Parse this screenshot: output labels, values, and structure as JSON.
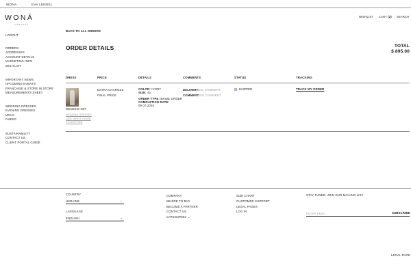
{
  "topbar": {
    "brand1": "WONA",
    "brand2": "EVA LENDEL"
  },
  "header": {
    "logo": "WONĀ",
    "logo_sub": "CONCEPT",
    "wishlist": "WISHLIST",
    "cart": "CART",
    "cart_count": "(2)",
    "search": "SEARCH"
  },
  "sidebar": {
    "logout": "LOGOUT",
    "account": [
      "ORDERS",
      "ADDRESSES",
      "ACCOUNT DETAILS",
      "MARKETING INFO",
      "WISH LIST"
    ],
    "info": [
      "IMPORTANT NEWS",
      "UPCOMING EVENTS",
      "FRANCHISE & STORE IN STORE",
      "MEASUREMENTS SHEET"
    ],
    "catalog": [
      "WEDDING DRESSES",
      "EVENING DRESSES",
      "VEILS",
      "FABRIC"
    ],
    "more": [
      "SUSTAINABILITY",
      "CONTACT US",
      "CLIENT PORTAL GUIDE"
    ]
  },
  "main": {
    "back": "BACK TO ALL ORDERS",
    "title": "ORDER DETAILS",
    "total_label": "TOTAL",
    "total_value": "$ 895.00",
    "columns": [
      "DRESS",
      "PRICE",
      "DETAILS",
      "COMMENTS",
      "STATUS",
      "TRACKING"
    ],
    "order": {
      "dress_name": "GENESIS SET",
      "dress_tags": [
        "WEDDING DRESSES",
        "LIBS",
        "WHITE",
        "DEMIN COLLECTION"
      ],
      "price_lines": [
        "EXTRA CHARGES",
        "FINAL PRICE"
      ],
      "color_label": "COLOR:",
      "color_value": "IVORY",
      "size_label": "SIZE:",
      "size_value": "42",
      "order_type_label": "ORDER TYPE:",
      "order_type_value": "BRIDE ORDER",
      "completion_label": "COMPLETION DATE:",
      "completion_value": "09.07.2026",
      "delivery_label": "DELIVERY:",
      "delivery_value": "NO COMMENT",
      "comment_label": "COMMENT:",
      "comment_value": "NO COMMENT",
      "status": "SHIPPED",
      "status_color": "#b5b0d8",
      "tracking": "TRACK MY ORDER"
    }
  },
  "footer": {
    "country_label": "COUNTRY",
    "country_value": "UKRAINE",
    "language_label": "LANGUAGE",
    "language_value": "ENGLISH",
    "col1": [
      "COMPANY",
      "WHERE TO BUY",
      "BECOME A PARTNER",
      "CONTACT US",
      "CATEGORIES"
    ],
    "col2": [
      "SIZE CHART",
      "CUSTOMER SUPPORT",
      "LEGAL PAGES",
      "LOG IN"
    ],
    "mailing_label": "STAY TUNED, JOIN OUR MAILING LIST",
    "email_placeholder": "ENTER EMAIL",
    "subscribe": "SUBSCRIBE",
    "legal": "LEGAL PAGE"
  }
}
